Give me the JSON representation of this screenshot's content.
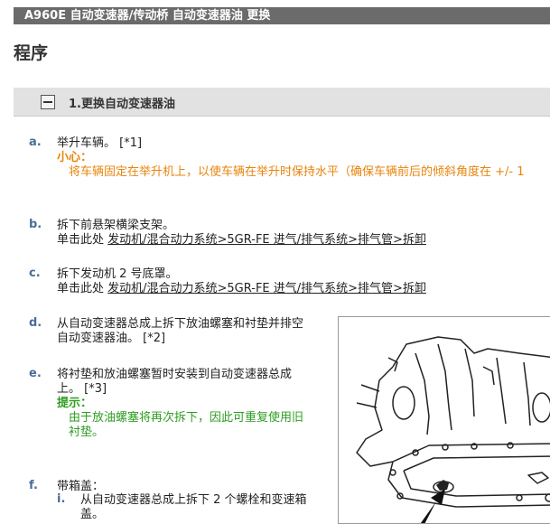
{
  "header": {
    "bar_title": "A960E 自动变速器/传动桥  自动变速器油  更换"
  },
  "page": {
    "title": "程序"
  },
  "section": {
    "title": "1.更换自动变速器油"
  },
  "steps": [
    {
      "marker": "a.",
      "text": "举升车辆。 [*1]",
      "caution_label": "小心：",
      "caution_text": "将车辆固定在举升机上，以使车辆在举升时保持水平（确保车辆前后的倾斜角度在 +/- 1"
    },
    {
      "marker": "b.",
      "text": "拆下前悬架横梁支架。",
      "ref_prefix": "单击此处 ",
      "ref_link": "发动机/混合动力系统>5GR-FE 进气/排气系统>排气管>拆卸"
    },
    {
      "marker": "c.",
      "text": "拆下发动机 2 号底罩。",
      "ref_prefix": "单击此处 ",
      "ref_link": "发动机/混合动力系统>5GR-FE 进气/排气系统>排气管>拆卸"
    },
    {
      "marker": "d.",
      "line1": "从自动变速器总成上拆下放油螺塞和衬垫并排空",
      "line2": "自动变速器油。 [*2]"
    },
    {
      "marker": "e.",
      "line1": "将衬垫和放油螺塞暂时安装到自动变速器总成",
      "line2": "上。 [*3]",
      "hint_label": "提示：",
      "hint_line1": "由于放油螺塞将再次拆下，因此可重复使用旧",
      "hint_line2": "衬垫。"
    },
    {
      "marker": "f.",
      "text": "带箱盖：",
      "sub_marker": "i.",
      "sub_line1": "从自动变速器总成上拆下 2 个螺栓和变速箱",
      "sub_line2": "盖。"
    }
  ],
  "icons": {
    "collapse": "collapse-minus-icon",
    "figure": "transmission-drain-plug-illustration",
    "arrow": "arrow-icon"
  },
  "colors": {
    "header_bar": "#6b6b6b",
    "marker": "#4a6d9a",
    "caution": "#e8850c",
    "hint": "#2e9d22"
  }
}
